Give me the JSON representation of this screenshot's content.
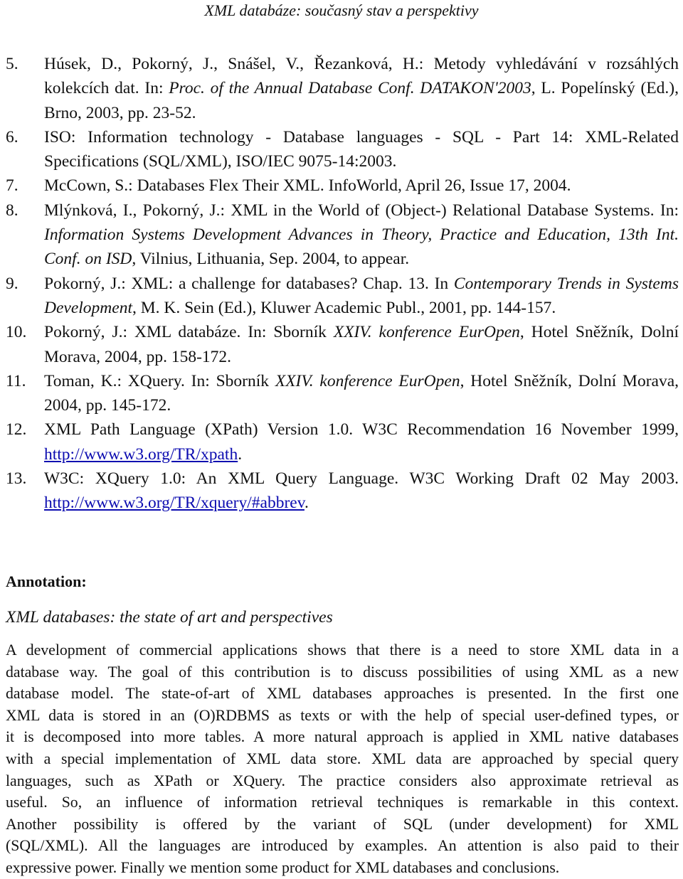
{
  "header": {
    "title": "XML databáze: současný stav a perspektivy"
  },
  "references": [
    {
      "num": "5.",
      "parts": [
        {
          "t": "Húsek, D., Pokorný, J., Snášel, V., Řezanková, H.: Metody vyhledávání v rozsáhlých kolekcích dat. In: "
        },
        {
          "t": "Proc. of the Annual Database Conf. DATAKON'2003",
          "style": "italic"
        },
        {
          "t": ", L. Popelínský (Ed.), Brno, 2003, pp. 23-52."
        }
      ]
    },
    {
      "num": "6.",
      "parts": [
        {
          "t": "ISO: Information technology - Database languages - SQL - Part 14: XML-Related Specifications (SQL/XML), ISO/IEC 9075-14:2003."
        }
      ]
    },
    {
      "num": "7.",
      "parts": [
        {
          "t": "McCown, S.: Databases Flex Their XML. InfoWorld, April 26, Issue 17, 2004."
        }
      ]
    },
    {
      "num": "8.",
      "parts": [
        {
          "t": "Mlýnková, I., Pokorný, J.: XML in the World of (Object-) Relational Database Systems. In: "
        },
        {
          "t": "Information Systems  Development Advances in Theory, Practice and Education, 13th Int. Conf. on ISD",
          "style": "italic"
        },
        {
          "t": ", Vilnius, Lithuania, Sep. 2004, to appear."
        }
      ]
    },
    {
      "num": "9.",
      "parts": [
        {
          "t": "Pokorný, J.: XML: a challenge for databases? Chap. 13. In "
        },
        {
          "t": "Contemporary Trends in Systems Development",
          "style": "italic"
        },
        {
          "t": ", M. K. Sein (Ed.), Kluwer Academic Publ., 2001, pp. 144-157."
        }
      ]
    },
    {
      "num": "10.",
      "parts": [
        {
          "t": "Pokorný, J.: XML databáze. In: Sborník "
        },
        {
          "t": "XXIV. konference EurOpen",
          "style": "italic"
        },
        {
          "t": ", Hotel Sněžník, Dolní Morava, 2004, pp. 158-172."
        }
      ]
    },
    {
      "num": "11.",
      "parts": [
        {
          "t": "Toman, K.: XQuery. In: Sborník "
        },
        {
          "t": "XXIV. konference EurOpen",
          "style": "italic"
        },
        {
          "t": ", Hotel Sněžník, Dolní Morava, 2004, pp. 145-172."
        }
      ]
    },
    {
      "num": "12.",
      "parts": [
        {
          "t": "XML Path Language (XPath) Version 1.0. W3C Recommendation 16 November 1999, "
        },
        {
          "t": "http://www.w3.org/TR/xpath",
          "style": "link"
        },
        {
          "t": "."
        }
      ]
    },
    {
      "num": "13.",
      "parts": [
        {
          "t": "W3C:  XQuery 1.0: An XML Query Language. W3C Working Draft 02 May 2003. "
        },
        {
          "t": "http://www.w3.org/TR/xquery/#abbrev",
          "style": "link"
        },
        {
          "t": "."
        }
      ]
    }
  ],
  "annotation": {
    "heading": "Annotation:",
    "title": "XML databases: the state of art and perspectives",
    "abstract_lines": [
      "A development of commercial applications shows that there is a need to store XML data in a",
      "database way. The goal of this contribution is to discuss possibilities of using XML as a new",
      "database model. The state-of-art of XML databases approaches is presented. In the first one",
      "XML data is stored in an (O)RDBMS as texts or with the help of special user-defined types, or",
      "it is decomposed into more tables. A more natural approach is applied in XML native databases",
      "with a special implementation of XML data store. XML data are approached by special query",
      "languages, such as XPath or XQuery. The practice considers also approximate retrieval as",
      "useful. So, an influence of information retrieval techniques is remarkable in this context.",
      "Another possibility is offered by the variant of SQL (under development) for XML",
      "(SQL/XML). All the languages are introduced by examples. An attention is also paid to their",
      "expressive power. Finally we mention some product for XML databases and conclusions."
    ]
  },
  "colors": {
    "link": "#0b0bb0",
    "text": "#111111"
  }
}
